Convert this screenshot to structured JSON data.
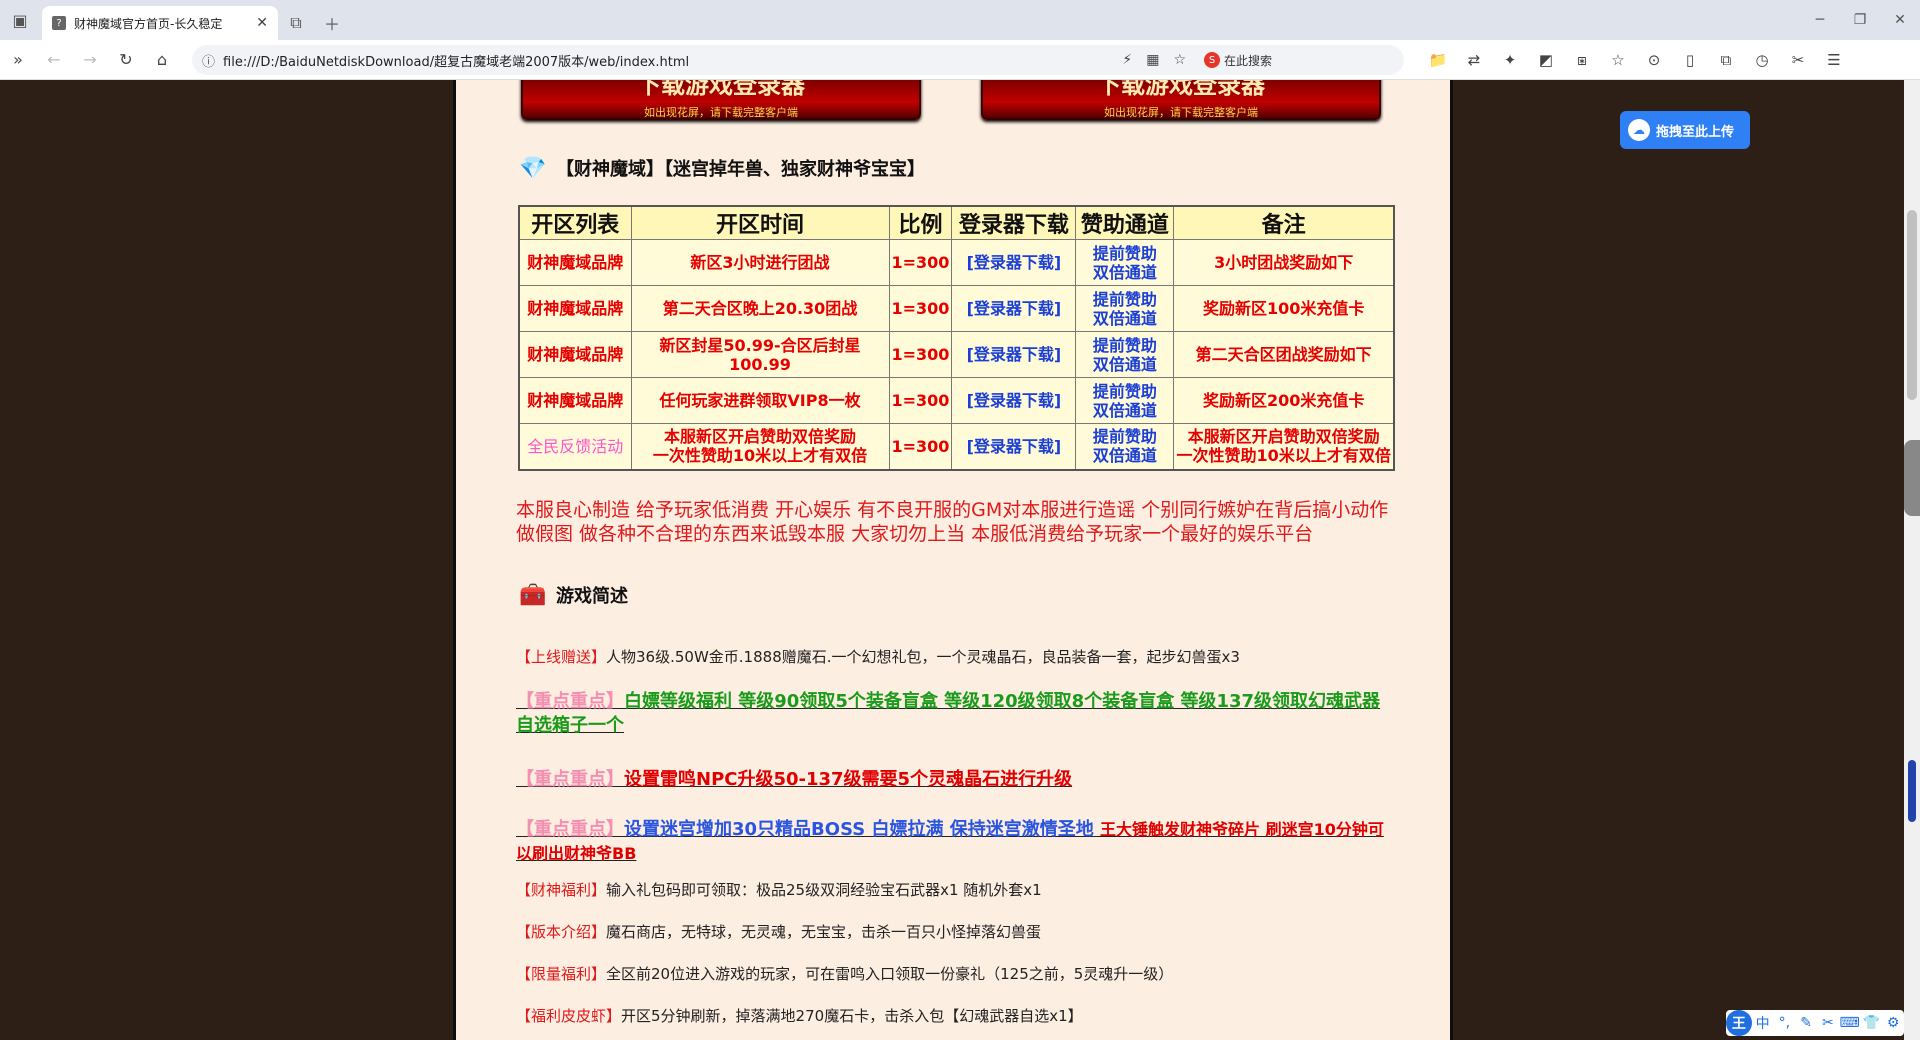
{
  "browser": {
    "tab_title": "财神魔域官方首页-长久稳定",
    "tab_favicon": "?",
    "url": "file:///D:/BaiduNetdiskDownload/超复古魔域老端2007版本/web/index.html",
    "search_placeholder": "在此搜索",
    "search_engine_badge": "S"
  },
  "page": {
    "banner_big": "下载游戏登录器",
    "banner_small": "如出现花屏，请下载完整客户端",
    "section1_title": "【财神魔域】【迷宫掉年兽、独家财神爷宝宝】",
    "table": {
      "headers": [
        "开区列表",
        "开区时间",
        "比例",
        "登录器下载",
        "赞助通道",
        "备注"
      ],
      "rows": [
        {
          "list": "财神魔域品牌",
          "time": "新区3小时进行团战",
          "ratio": "1=300",
          "download": "[登录器下载]",
          "pass": "提前赞助\n双倍通道",
          "note": "3小时团战奖励如下"
        },
        {
          "list": "财神魔域品牌",
          "time": "第二天合区晚上20.30团战",
          "ratio": "1=300",
          "download": "[登录器下载]",
          "pass": "提前赞助\n双倍通道",
          "note": "奖励新区100米充值卡"
        },
        {
          "list": "财神魔域品牌",
          "time": "新区封星50.99-合区后封星100.99",
          "ratio": "1=300",
          "download": "[登录器下载]",
          "pass": "提前赞助\n双倍通道",
          "note": "第二天合区团战奖励如下"
        },
        {
          "list": "财神魔域品牌",
          "time": "任何玩家进群领取VIP8一枚",
          "ratio": "1=300",
          "download": "[登录器下载]",
          "pass": "提前赞助\n双倍通道",
          "note": "奖励新区200米充值卡"
        },
        {
          "list": "全民反馈活动",
          "time": "本服新区开启赞助双倍奖励\n一次性赞助10米以上才有双倍",
          "ratio": "1=300",
          "download": "[登录器下载]",
          "pass": "提前赞助\n双倍通道",
          "note": "本服新区开启赞助双倍奖励\n一次性赞助10米以上才有双倍"
        }
      ]
    },
    "notice_line1": "本服良心制造 给予玩家低消费 开心娱乐 有不良开服的GM对本服进行造谣 个别同行嫉妒在背后搞小动作",
    "notice_line2": "做假图 做各种不合理的东西来诋毁本服 大家切勿上当 本服低消费给予玩家一个最好的娱乐平台",
    "section2_title": "游戏简述",
    "info": [
      {
        "tag": "【上线赠送】",
        "text": "人物36级.50W金币.1888赠魔石.一个幻想礼包，一个灵魂晶石，良品装备一套，起步幻兽蛋x3"
      },
      {
        "tag": "【财神福利】",
        "text": "输入礼包码即可领取：极品25级双洞经验宝石武器x1 随机外套x1"
      },
      {
        "tag": "【版本介绍】",
        "text": "魔石商店，无特球，无灵魂，无宝宝，击杀一百只小怪掉落幻兽蛋"
      },
      {
        "tag": "【限量福利】",
        "text": "全区前20位进入游戏的玩家，可在雷鸣入口领取一份豪礼（125之前，5灵魂升一级）"
      },
      {
        "tag": "【福利皮皮虾】",
        "text": "开区5分钟刷新，掉落满地270魔石卡，击杀入包【幻魂武器自选x1】"
      }
    ],
    "highlights": [
      {
        "tag": "【重点重点】",
        "text": "白嫖等级福利 等级90领取5个装备盲盒 等级120级领取8个装备盲盒 等级137级领取幻魂武器自选箱子一个",
        "extra": ""
      },
      {
        "tag": "【重点重点】",
        "text": "设置雷鸣NPC升级50-137级需要5个灵魂晶石进行升级",
        "extra": ""
      },
      {
        "tag": "【重点重点】",
        "text": "设置迷宫增加30只精品BOSS 白嫖拉满 保持迷宫激情圣地",
        "extra": "王大锤触发财神爷碎片 刷迷宫10分钟可以刷出财神爷BB"
      }
    ]
  },
  "baidu_upload": "拖拽至此上传",
  "ime": [
    "王",
    "中",
    "°,",
    "✎",
    "✂",
    "⌨",
    "👕",
    "⚙"
  ]
}
